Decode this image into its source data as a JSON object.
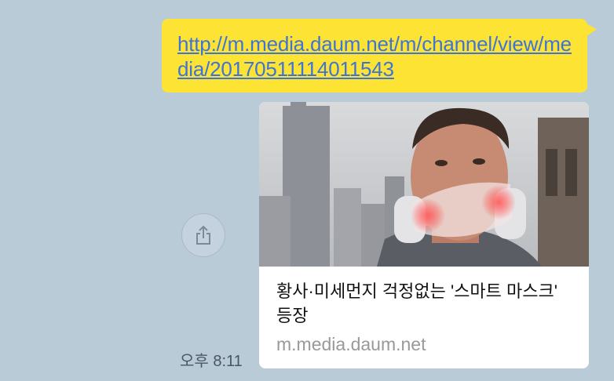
{
  "message": {
    "url_text": "http://m.media.daum.net/m/channel/view/media/20170511114011543"
  },
  "link_preview": {
    "title": "황사·미세먼지 걱정없는 '스마트 마스크' 등장",
    "domain": "m.media.daum.net",
    "thumbnail_icon": "man-wearing-smart-mask-photo"
  },
  "share_button": {
    "icon": "share-icon"
  },
  "timestamp": "오후 8:11",
  "colors": {
    "background": "#bacbd8",
    "bubble": "#fde334",
    "link": "#3d74d9",
    "domain_text": "#999999"
  }
}
